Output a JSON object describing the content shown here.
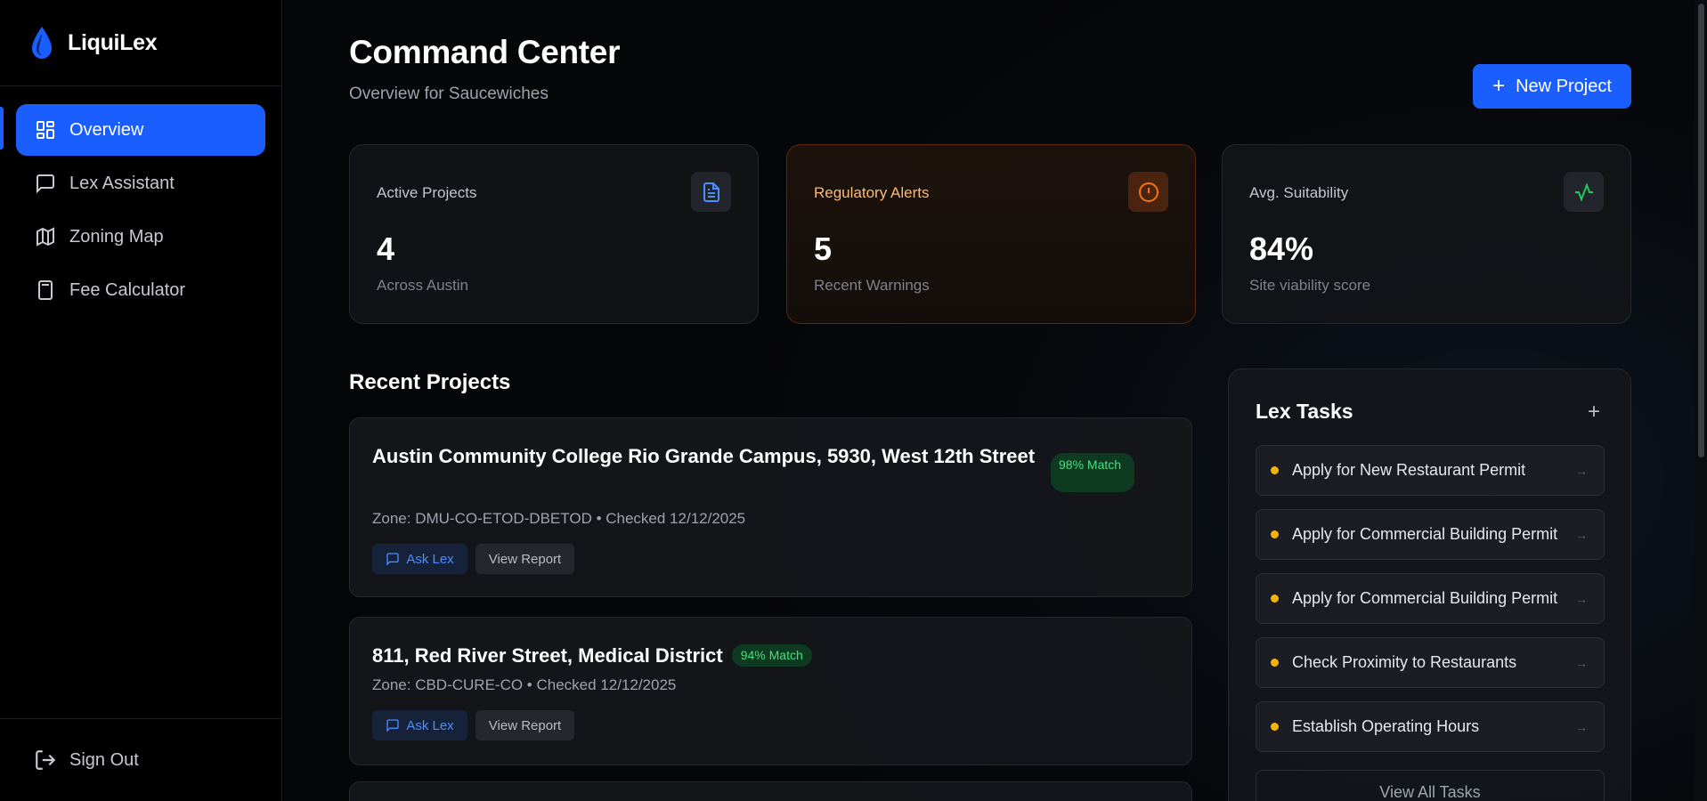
{
  "brand": {
    "name": "LiquiLex",
    "logo": "drop-logo-icon",
    "accent": "#1a5eff"
  },
  "sidebar": {
    "items": [
      {
        "label": "Overview",
        "icon": "grid-icon",
        "active": true
      },
      {
        "label": "Lex Assistant",
        "icon": "chat-icon",
        "active": false
      },
      {
        "label": "Zoning Map",
        "icon": "map-icon",
        "active": false
      },
      {
        "label": "Fee Calculator",
        "icon": "calculator-icon",
        "active": false
      }
    ],
    "signout": {
      "label": "Sign Out",
      "icon": "sign-out-icon"
    }
  },
  "header": {
    "title": "Command Center",
    "subtitle": "Overview for Saucewiches",
    "new_project_label": "New Project"
  },
  "stats": [
    {
      "label": "Active Projects",
      "value": "4",
      "sub": "Across Austin",
      "icon": "document-icon",
      "icon_color": "#4c8dff"
    },
    {
      "label": "Regulatory Alerts",
      "value": "5",
      "sub": "Recent Warnings",
      "icon": "alert-icon",
      "icon_color": "#f97316"
    },
    {
      "label": "Avg. Suitability",
      "value": "84%",
      "sub": "Site viability score",
      "icon": "activity-icon",
      "icon_color": "#22c55e"
    }
  ],
  "recent": {
    "title": "Recent Projects",
    "projects": [
      {
        "title": "Austin Community College Rio Grande Campus, 5930, West 12th Street",
        "match": "98% Match",
        "meta": "Zone: DMU-CO-ETOD-DBETOD • Checked 12/12/2025",
        "ask_label": "Ask Lex",
        "view_label": "View Report"
      },
      {
        "title": "811, Red River Street, Medical District",
        "match": "94% Match",
        "meta": "Zone: CBD-CURE-CO • Checked 12/12/2025",
        "ask_label": "Ask Lex",
        "view_label": "View Report"
      }
    ]
  },
  "tasks": {
    "title": "Lex Tasks",
    "add_label": "+",
    "items": [
      {
        "label": "Apply for New Restaurant Permit",
        "status_color": "#f5b40a"
      },
      {
        "label": "Apply for Commercial Building Permit",
        "status_color": "#f5b40a"
      },
      {
        "label": "Apply for Commercial Building Permit",
        "status_color": "#f5b40a"
      },
      {
        "label": "Check Proximity to Restaurants",
        "status_color": "#f5b40a"
      },
      {
        "label": "Establish Operating Hours",
        "status_color": "#f5b40a"
      }
    ],
    "view_all_label": "View All Tasks"
  }
}
